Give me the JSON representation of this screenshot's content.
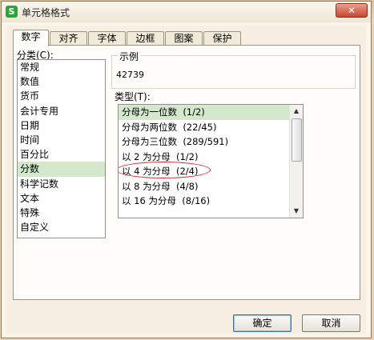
{
  "window": {
    "title": "单元格格式",
    "app_icon_letter": "S",
    "close_glyph": "✕"
  },
  "tabs": [
    {
      "label": "数字",
      "active": true
    },
    {
      "label": "对齐"
    },
    {
      "label": "字体"
    },
    {
      "label": "边框"
    },
    {
      "label": "图案"
    },
    {
      "label": "保护"
    }
  ],
  "category": {
    "label": "分类(C):",
    "items": [
      "常规",
      "数值",
      "货币",
      "会计专用",
      "日期",
      "时间",
      "百分比",
      "分数",
      "科学记数",
      "文本",
      "特殊",
      "自定义"
    ],
    "selected": "分数"
  },
  "sample": {
    "label": "示例",
    "value": "42739"
  },
  "type": {
    "label": "类型(T):",
    "items": [
      {
        "name": "分母为一位数",
        "fmt": "(1/2)"
      },
      {
        "name": "分母为两位数",
        "fmt": "(22/45)"
      },
      {
        "name": "分母为三位数",
        "fmt": "(289/591)"
      },
      {
        "name": "以 2 为分母",
        "fmt": "(1/2)"
      },
      {
        "name": "以 4 为分母",
        "fmt": "(2/4)"
      },
      {
        "name": "以 8 为分母",
        "fmt": "(4/8)"
      },
      {
        "name": "以 16 为分母",
        "fmt": "(8/16)"
      }
    ],
    "selected_index": 0,
    "highlighted_index": 4
  },
  "buttons": {
    "ok": "确定",
    "cancel": "取消"
  },
  "colors": {
    "selection": "#d4e8cc",
    "annotation": "#d8232a",
    "close": "#c8452c"
  }
}
